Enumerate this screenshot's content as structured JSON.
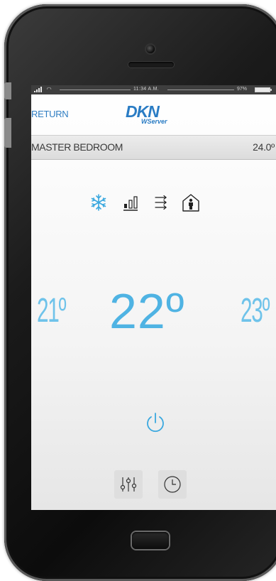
{
  "status_bar": {
    "time": "11:34 A.M.",
    "battery_percent": "97%"
  },
  "header": {
    "return_label": "RETURN",
    "logo_brand": "DKN",
    "logo_sub": "WServer"
  },
  "room": {
    "name": "MASTER BEDROOM",
    "temperature": "24.0º"
  },
  "modes": [
    {
      "icon": "snowflake-icon"
    },
    {
      "icon": "fan-speed-icon"
    },
    {
      "icon": "airflow-direction-icon"
    },
    {
      "icon": "occupancy-icon"
    }
  ],
  "setpoint": {
    "lower": "21º",
    "current": "22º",
    "higher": "23º"
  },
  "colors": {
    "accent": "#4fb3e3",
    "link": "#2e7dc2"
  }
}
